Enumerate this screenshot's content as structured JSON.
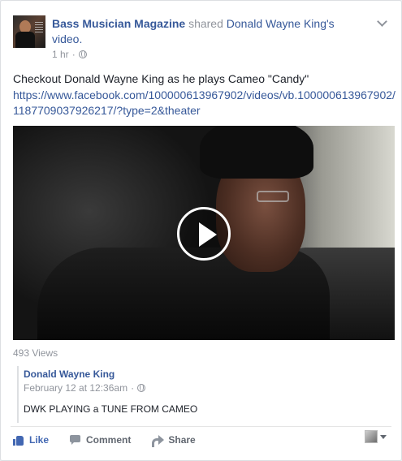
{
  "post": {
    "page_name": "Bass Musician Magazine",
    "shared_text": "shared",
    "original_author": "Donald Wayne King's",
    "object": "video.",
    "time": "1 hr",
    "separator": "·",
    "body": "Checkout Donald Wayne King as he plays Cameo \"Candy\"",
    "url": "https://www.facebook.com/100000613967902/videos/vb.100000613967902/1187709037926217/?type=2&theater"
  },
  "video": {
    "views": "493 Views"
  },
  "shared_post": {
    "author": "Donald Wayne King",
    "date": "February 12 at 12:36am",
    "separator": "·",
    "caption": "DWK PLAYING a TUNE FROM CAMEO"
  },
  "actions": {
    "like": "Like",
    "comment": "Comment",
    "share": "Share"
  },
  "icons": {
    "privacy": "globe-icon",
    "menu": "chevron-down-icon",
    "like": "thumbs-up-icon",
    "comment": "comment-bubble-icon",
    "share": "share-arrow-icon",
    "play": "play-icon"
  },
  "colors": {
    "link": "#365899",
    "like_active": "#4267b2",
    "muted": "#90949c"
  }
}
